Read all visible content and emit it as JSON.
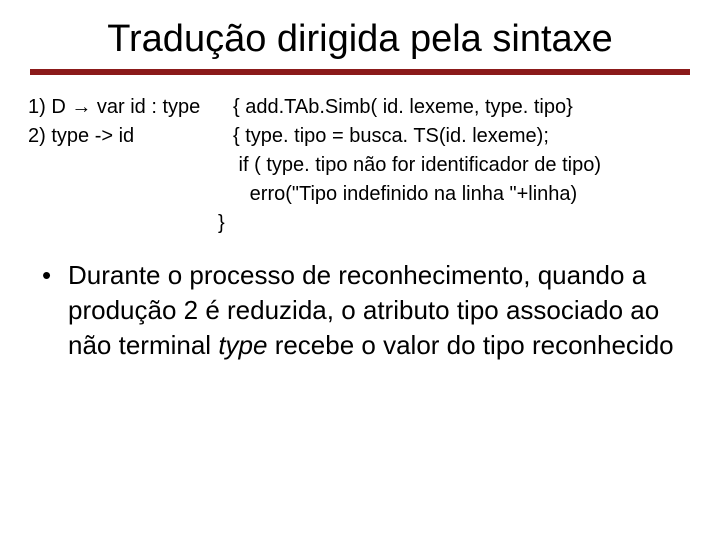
{
  "title": "Tradução dirigida pela sintaxe",
  "grammar": {
    "r1_lhs": "1) D → var id : type",
    "r1_rhs": "{ add.TAb.Simb( id. lexeme, type. tipo}",
    "r2_lhs": "2) type -> id",
    "r2_rhs": "{ type. tipo = busca. TS(id. lexeme);",
    "l3": " if ( type. tipo não for identificador de tipo)",
    "l4": "   erro(\"Tipo indefinido na linha \"+linha)",
    "l5": "}"
  },
  "bullet": {
    "dot": "•",
    "pre": "Durante o processo de reconhecimento, quando a produção 2 é reduzida, o atributo tipo associado ao não terminal ",
    "em": "type",
    "post": " recebe o valor do tipo reconhecido"
  }
}
